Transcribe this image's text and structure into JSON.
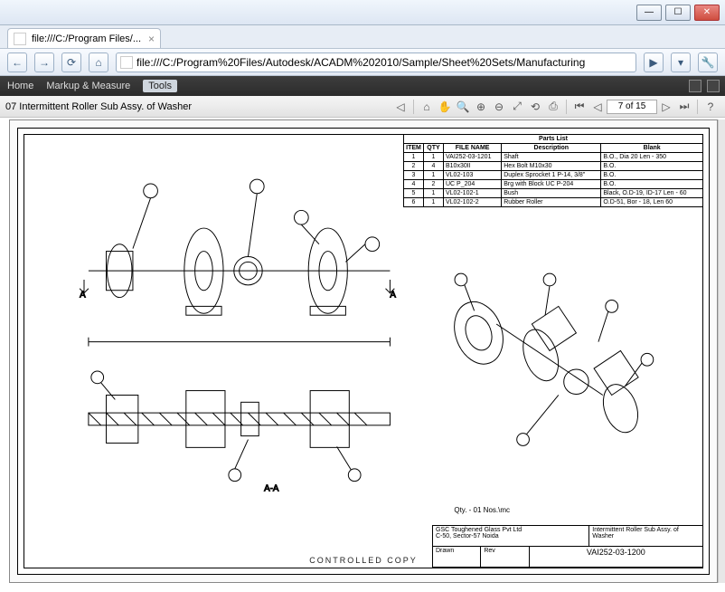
{
  "window": {
    "min": "—",
    "max": "☐",
    "close": "✕"
  },
  "tab": {
    "title": "file:///C:/Program Files/...",
    "close": "×"
  },
  "address": {
    "back": "←",
    "forward": "→",
    "reload": "⟳",
    "home": "⌂",
    "value": "file:///C:/Program%20Files/Autodesk/ACADM%202010/Sample/Sheet%20Sets/Manufacturing",
    "go": "▶",
    "page": "▾",
    "tools": "🔧"
  },
  "viewer_menu": {
    "home": "Home",
    "markup": "Markup & Measure",
    "tools": "Tools"
  },
  "toolbar": {
    "sheet_name": "07 Intermittent Roller Sub Assy. of Washer",
    "page_display": "7 of 15",
    "icons": {
      "prev_sheet": "◁",
      "home": "⌂",
      "pan": "✋",
      "zoom_win": "🔍",
      "zoom_in": "⊕",
      "zoom_out": "⊖",
      "fit": "⤢",
      "rotate": "⟲",
      "print": "⎙",
      "sep": "|",
      "first": "⏮",
      "prev": "◁",
      "next": "▷",
      "last": "⏭",
      "help": "?"
    }
  },
  "parts_list": {
    "title": "Parts List",
    "headers": {
      "item": "ITEM",
      "qty": "QTY",
      "file": "FILE NAME",
      "desc": "Description",
      "blank": "Blank"
    },
    "rows": [
      {
        "item": "1",
        "qty": "1",
        "file": "VAI252-03-1201",
        "desc": "Shaft",
        "blank": "B.O., Dia 20 Len - 350"
      },
      {
        "item": "2",
        "qty": "4",
        "file": "B10x30II",
        "desc": "Hex Bolt M10x30",
        "blank": "B.O."
      },
      {
        "item": "3",
        "qty": "1",
        "file": "VL02-103",
        "desc": "Duplex Sprocket 1 P-14, 3/8\"",
        "blank": "B.O."
      },
      {
        "item": "4",
        "qty": "2",
        "file": "UC P_204",
        "desc": "Brg with Block UC P-204",
        "blank": "B.O."
      },
      {
        "item": "5",
        "qty": "1",
        "file": "VL02-102-1",
        "desc": "Bush",
        "blank": "Black, O.D-19, ID-17 Len - 60"
      },
      {
        "item": "6",
        "qty": "1",
        "file": "VL02-102-2",
        "desc": "Rubber Roller",
        "blank": "O.D-51, Bor - 18, Len 60"
      }
    ]
  },
  "drawing": {
    "section_label": "A-A",
    "marker_a_left": "A",
    "marker_a_right": "A",
    "qty_note": "Qty. - 01 Nos.\\mc",
    "controlled": "CONTROLLED COPY"
  },
  "titleblock": {
    "company": "GSC Toughened Glass Pvt Ltd",
    "address": "C-50, Sector-57 Noida",
    "title": "Intermittent Roller Sub Assy. of Washer",
    "dwgno": "VAI252-03-1200",
    "col_a": "Drawn",
    "col_b": "Rev"
  }
}
